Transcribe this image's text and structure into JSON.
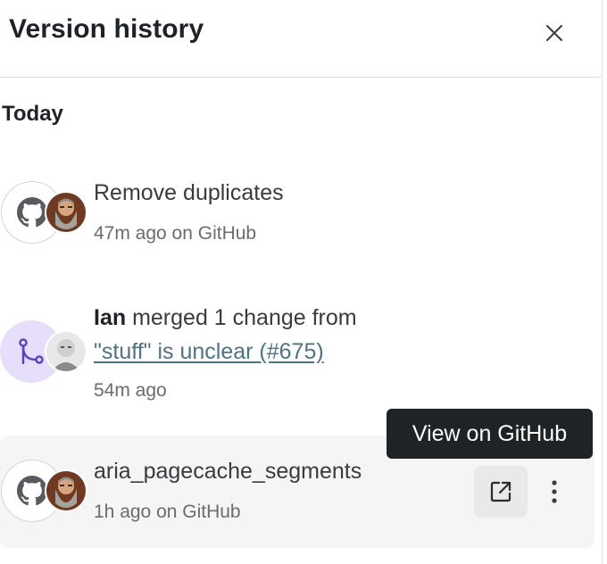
{
  "header": {
    "title": "Version history",
    "close_icon": "close-icon"
  },
  "sections": [
    {
      "label": "Today",
      "entries": [
        {
          "kind": "github-commit",
          "title": "Remove duplicates",
          "meta": "47m ago on GitHub",
          "icon": "github-icon"
        },
        {
          "kind": "merge",
          "author": "Ian",
          "action": "merged 1 change from",
          "link": "\"stuff\" is unclear (#675)",
          "meta": "54m ago",
          "icon": "merge-icon"
        },
        {
          "kind": "github-commit",
          "title": "aria_pagecache_segments",
          "meta": "1h ago on GitHub",
          "icon": "github-icon",
          "actions": [
            "external-link-icon",
            "more-vertical-icon"
          ]
        }
      ]
    }
  ],
  "tooltip": "View on GitHub",
  "colors": {
    "merge_accent": "#5b3fc4",
    "merge_bg": "#e6defa",
    "link": "#4f7285",
    "tooltip_bg": "#1f2326",
    "hover_row_bg": "#f5f5f6"
  }
}
